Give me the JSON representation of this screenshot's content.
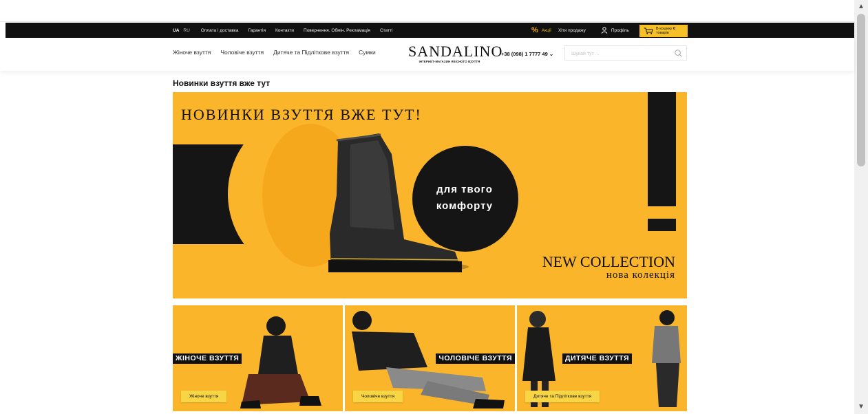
{
  "colors": {
    "brand_yellow": "#fbb52a",
    "brand_black": "#111111",
    "promo_accent": "#f2b51b",
    "cart_yellow": "#f5c127"
  },
  "utility_bar": {
    "lang_active": "UA",
    "lang_other": "RU",
    "links": [
      "Оплата і доставка",
      "Гарантія",
      "Контакти",
      "Повернення. Обмін. Рекламація",
      "Статті"
    ],
    "promo_icon": "percent-icon",
    "promo_label": "Акції",
    "bestsellers": "Хіти продажу",
    "profile_icon": "user-icon",
    "profile": "Профіль",
    "cart_icon": "cart-icon",
    "cart_line1": "В кошику",
    "cart_count": "0",
    "cart_line2": "товарів"
  },
  "header": {
    "nav": [
      "Жіноче взуття",
      "Чоловіче взуття",
      "Дитяче та Підліткове взуття",
      "Сумки"
    ],
    "logo_name": "SANDALINO",
    "logo_tagline": "ІНТЕРНЕТ-МАГАЗИН ЯКІСНОГО ВЗУТТЯ",
    "phone": "+38 (098) 1 7777 49",
    "phone_icon": "chevron-down-icon",
    "search_placeholder": "Шукай тут ...",
    "search_icon": "search-icon"
  },
  "page_title": "Новинки взуття вже тут",
  "hero": {
    "title": "НОВИНКИ ВЗУТТЯ ВЖЕ ТУТ!",
    "circle_line1": "для твого",
    "circle_line2": "комфорту",
    "collection_en": "NEW COLLECTION",
    "collection_ua": "нова колекція"
  },
  "tiles": [
    {
      "banner": "ЖІНОЧЕ ВЗУТТЯ",
      "button": "Жіноче взуття"
    },
    {
      "banner": "ЧОЛОВІЧЕ ВЗУТТЯ",
      "button": "Чоловіче взуття"
    },
    {
      "banner": "ДИТЯЧЕ ВЗУТТЯ",
      "button": "Дитяче та Підліткове взуття"
    }
  ]
}
